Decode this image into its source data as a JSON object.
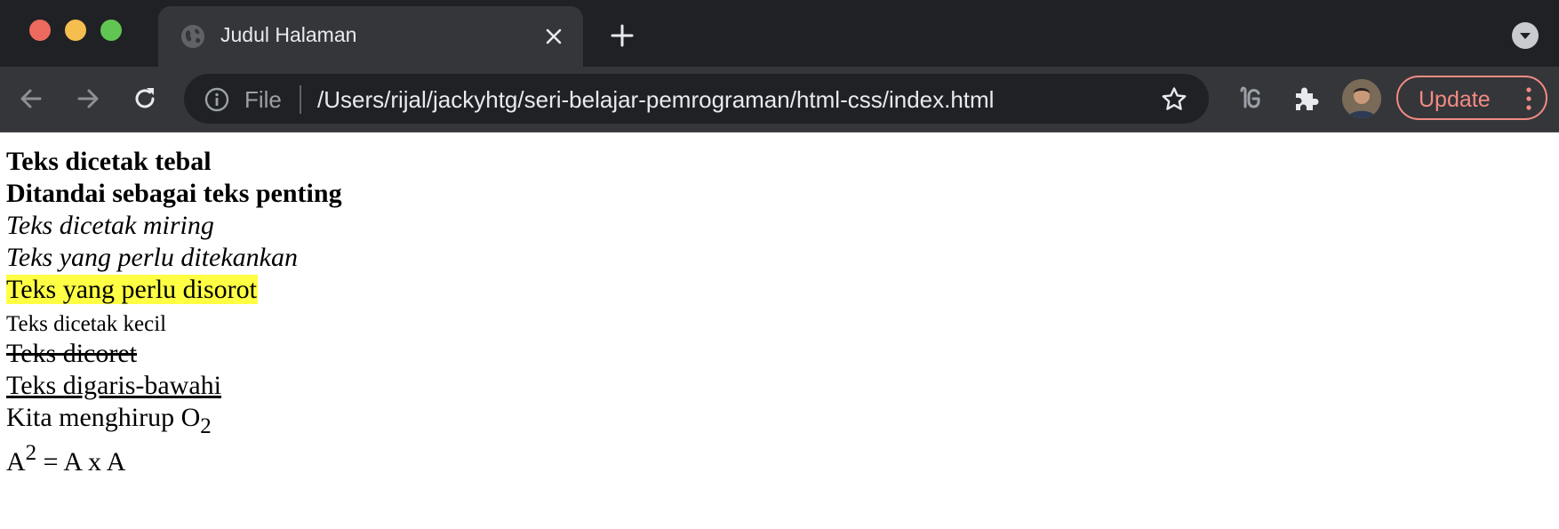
{
  "tab": {
    "title": "Judul Halaman"
  },
  "toolbar": {
    "scheme": "File",
    "url": "/Users/rijal/jackyhtg/seri-belajar-pemrograman/html-css/index.html",
    "update_label": "Update"
  },
  "content": {
    "bold": "Teks dicetak tebal",
    "strong": "Ditandai sebagai teks penting",
    "italic": "Teks dicetak miring",
    "em": "Teks yang perlu ditekankan",
    "mark": "Teks yang perlu disorot",
    "small": "Teks dicetak kecil",
    "del": "Teks dicoret",
    "ins": "Teks digaris-bawahi",
    "sub_prefix": "Kita menghirup O",
    "sub_value": "2",
    "sup_base": "A",
    "sup_value": "2",
    "sup_suffix": " = A x A"
  },
  "icons": {
    "tab_favicon": "globe-icon",
    "tab_close": "close-icon",
    "new_tab": "plus-icon",
    "tab_search": "chevron-down-icon",
    "back": "arrow-left-icon",
    "forward": "arrow-right-icon",
    "reload": "reload-icon",
    "site_info": "info-icon",
    "bookmark": "star-icon",
    "extension_g": "g-extension-icon",
    "extensions": "puzzle-icon",
    "profile": "avatar",
    "menu": "kebab-menu-icon"
  },
  "colors": {
    "highlight": "#ffff43",
    "update_accent": "#f28b82",
    "chrome_dark": "#202124",
    "chrome_toolbar": "#35363a"
  }
}
